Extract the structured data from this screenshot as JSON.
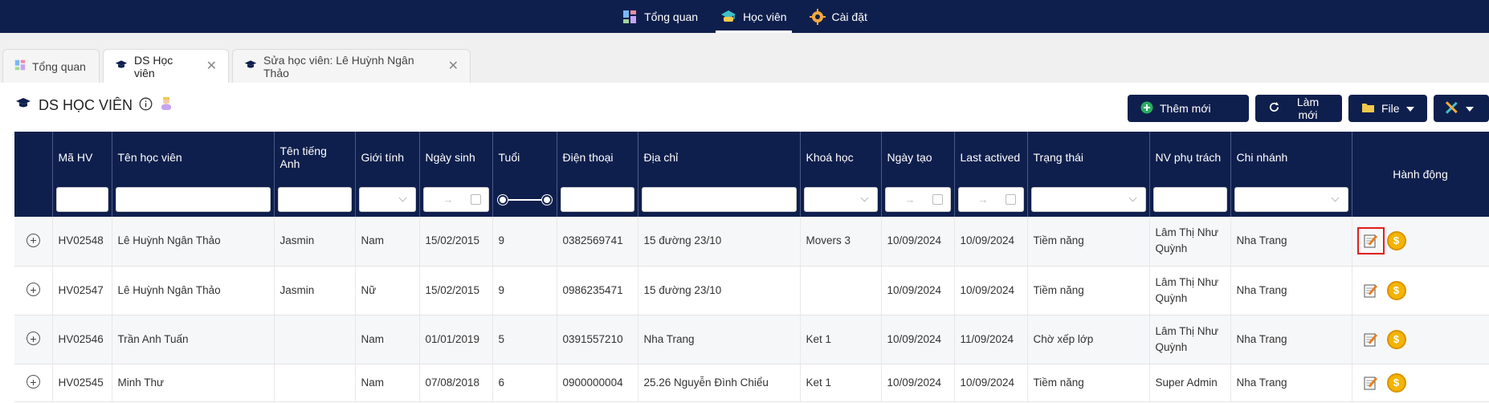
{
  "topnav": {
    "items": [
      {
        "label": "Tổng quan",
        "icon": "dashboard-icon"
      },
      {
        "label": "Học viên",
        "icon": "graduation-cap-icon",
        "active": true
      },
      {
        "label": "Cài đặt",
        "icon": "gear-icon"
      }
    ]
  },
  "tabs": [
    {
      "label": "Tổng quan",
      "icon": "dashboard-icon"
    },
    {
      "label": "DS Học viên",
      "icon": "graduation-cap-icon",
      "active": true
    },
    {
      "label": "Sửa học viên: Lê Huỳnh Ngân Thảo",
      "icon": "graduation-cap-icon"
    }
  ],
  "page": {
    "title": "DS HỌC VIÊN"
  },
  "toolbar": {
    "add_label": "Thêm mới",
    "refresh_label": "Làm mới",
    "file_label": "File"
  },
  "table": {
    "headers": {
      "code": "Mã HV",
      "name": "Tên học viên",
      "english_name": "Tên tiếng Anh",
      "gender": "Giới tính",
      "dob": "Ngày sinh",
      "age": "Tuổi",
      "phone": "Điện thoại",
      "address": "Địa chỉ",
      "course": "Khoá học",
      "created": "Ngày tạo",
      "last_active": "Last actived",
      "status": "Trạng thái",
      "staff": "NV phụ trách",
      "branch": "Chi nhánh",
      "actions": "Hành động"
    },
    "rows": [
      {
        "code": "HV02548",
        "name": "Lê Huỳnh Ngân Thảo",
        "english_name": "Jasmin",
        "gender": "Nam",
        "dob": "15/02/2015",
        "age": "9",
        "phone": "0382569741",
        "address": "15 đường 23/10",
        "course": "Movers 3",
        "created": "10/09/2024",
        "last_active": "10/09/2024",
        "status": "Tiềm năng",
        "staff": "Lâm Thị Như Quỳnh",
        "branch": "Nha Trang"
      },
      {
        "code": "HV02547",
        "name": "Lê Huỳnh Ngân Thảo",
        "english_name": "Jasmin",
        "gender": "Nữ",
        "dob": "15/02/2015",
        "age": "9",
        "phone": "0986235471",
        "address": "15 đường 23/10",
        "course": "",
        "created": "10/09/2024",
        "last_active": "10/09/2024",
        "status": "Tiềm năng",
        "staff": "Lâm Thị Như Quỳnh",
        "branch": "Nha Trang"
      },
      {
        "code": "HV02546",
        "name": "Trần Anh Tuấn",
        "english_name": "",
        "gender": "Nam",
        "dob": "01/01/2019",
        "age": "5",
        "phone": "0391557210",
        "address": "Nha Trang",
        "course": "Ket 1",
        "created": "10/09/2024",
        "last_active": "11/09/2024",
        "status": "Chờ xếp lớp",
        "staff": "Lâm Thị Như Quỳnh",
        "branch": "Nha Trang"
      },
      {
        "code": "HV02545",
        "name": "Minh Thư",
        "english_name": "",
        "gender": "Nam",
        "dob": "07/08/2018",
        "age": "6",
        "phone": "0900000004",
        "address": "25.26 Nguyễn Đình Chiểu",
        "course": "Ket 1",
        "created": "10/09/2024",
        "last_active": "10/09/2024",
        "status": "Tiềm năng",
        "staff": "Super Admin",
        "branch": "Nha Trang"
      }
    ]
  },
  "colors": {
    "primary": "#0f1f4d",
    "highlight": "#e0201c",
    "coin": "#f4b400"
  }
}
